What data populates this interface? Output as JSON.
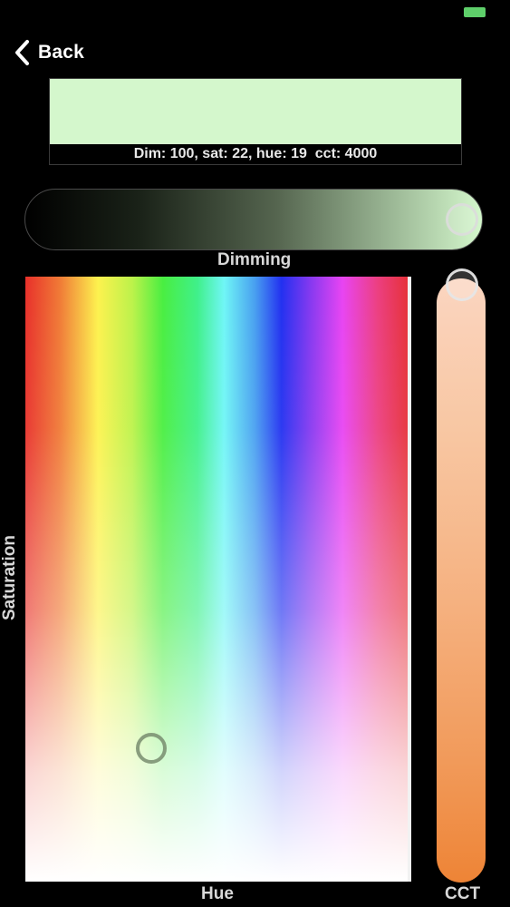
{
  "status_bar": {
    "battery_color": "#5ecf6a"
  },
  "nav": {
    "back_label": "Back",
    "back_icon": "chevron-left-icon"
  },
  "preview": {
    "swatch_color": "#d4f7cc",
    "info_text": "Dim: 100, sat: 22, hue: 19  cct: 4000"
  },
  "dimming": {
    "label": "Dimming",
    "value_percent": 100
  },
  "color_picker": {
    "hue_label": "Hue",
    "saturation_label": "Saturation",
    "selected_hue_fraction": 0.33,
    "selected_saturation_fraction": 0.22
  },
  "cct": {
    "label": "CCT",
    "value_fraction": 0.0
  }
}
